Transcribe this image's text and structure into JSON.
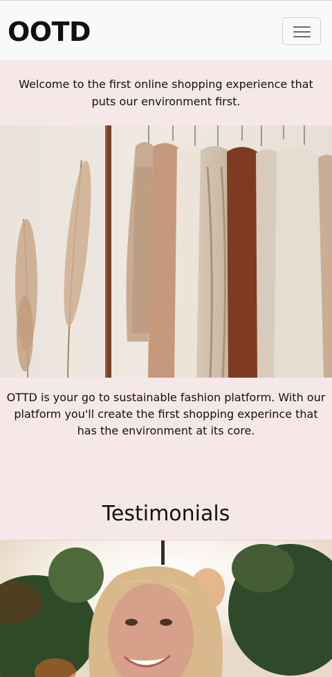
{
  "navbar": {
    "brand": "OOTD",
    "toggle_icon": "hamburger-menu-icon"
  },
  "welcome": {
    "text": "Welcome to the first online shopping experience that puts our environment first."
  },
  "hero": {
    "image": "clothing-rack-photo"
  },
  "about": {
    "text": "OTTD is your go to sustainable fashion platform. With our platform you'll create the first shopping experince that has the environment at its core."
  },
  "testimonials": {
    "heading": "Testimonials",
    "image": "testimonial-woman-photo"
  },
  "colors": {
    "page_background": "#f6e8e9",
    "navbar_background": "#f8f9fa",
    "text": "#111111"
  }
}
